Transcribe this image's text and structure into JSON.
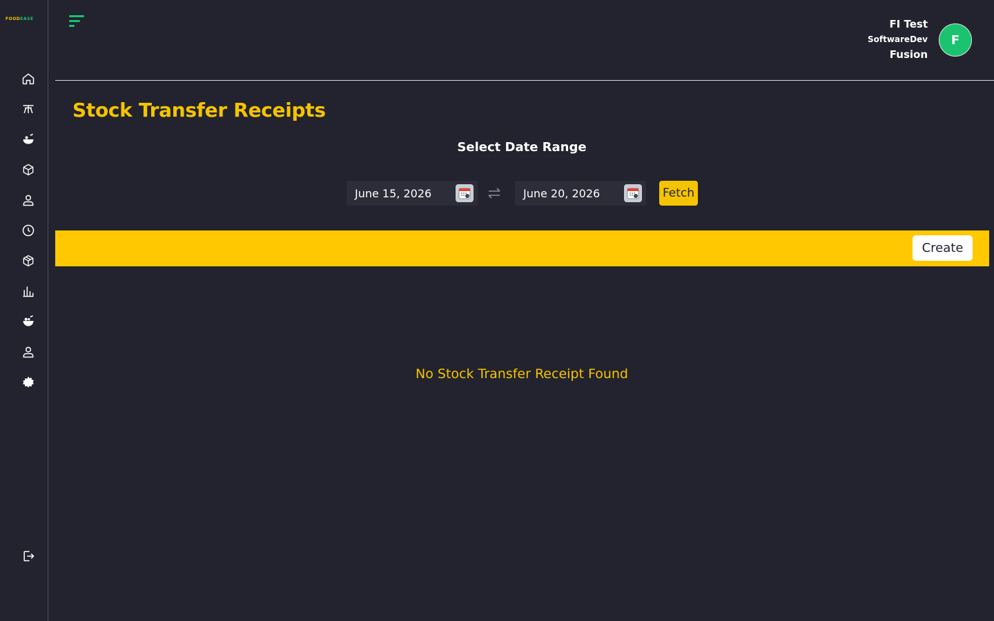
{
  "brand": {
    "logo_part1": "FOOD",
    "logo_part2": "EASE",
    "primary_color": "#f5c400",
    "accent_color": "#19c36f"
  },
  "sidebar": {
    "items": [
      {
        "icon": "home-icon"
      },
      {
        "icon": "dining-table-icon"
      },
      {
        "icon": "food-bowl-icon"
      },
      {
        "icon": "box-icon"
      },
      {
        "icon": "user-icon"
      },
      {
        "icon": "clock-icon"
      },
      {
        "icon": "package-icon"
      },
      {
        "icon": "bar-chart-icon"
      },
      {
        "icon": "food-plate-icon"
      },
      {
        "icon": "person-icon"
      },
      {
        "icon": "settings-gear-icon"
      }
    ],
    "logout_icon": "logout-icon"
  },
  "header": {
    "user_name": "FI Test",
    "company": "SoftwareDev",
    "branch": "Fusion",
    "avatar_letter": "F"
  },
  "page": {
    "title": "Stock Transfer Receipts",
    "range_heading": "Select Date Range",
    "start_date": "June 15, 2026",
    "end_date": "June 20, 2026",
    "fetch_label": "Fetch",
    "create_label": "Create",
    "empty_message": "No Stock Transfer Receipt Found"
  }
}
